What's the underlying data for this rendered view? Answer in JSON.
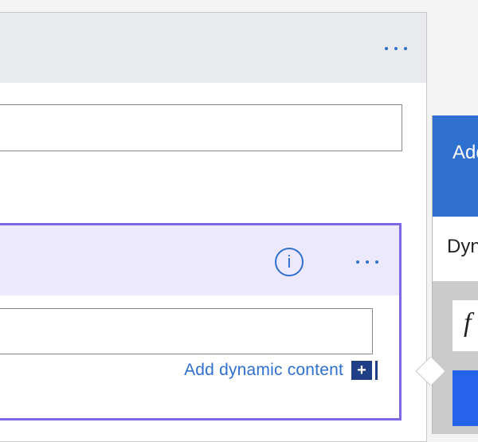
{
  "outer_card": {
    "menu_icon": "more-horizontal-icon"
  },
  "inner_card": {
    "info_icon": "info-icon",
    "info_glyph": "i",
    "menu_icon": "more-horizontal-icon",
    "add_dynamic_content": "Add dynamic content",
    "add_dynamic_icon": "plus-icon",
    "add_dynamic_glyph": "+"
  },
  "flyout": {
    "title": "Add dynamic content",
    "tab_label": "Dynamic content",
    "function_icon": "fx-icon",
    "function_glyph": "f"
  },
  "colors": {
    "accent_blue": "#2f6fd0",
    "selected_border": "#7b68e3",
    "selected_header": "#ece9fd",
    "card_header": "#e9eaee",
    "flyout_header": "#2f6fd0",
    "plus_box": "#1f3f86"
  }
}
